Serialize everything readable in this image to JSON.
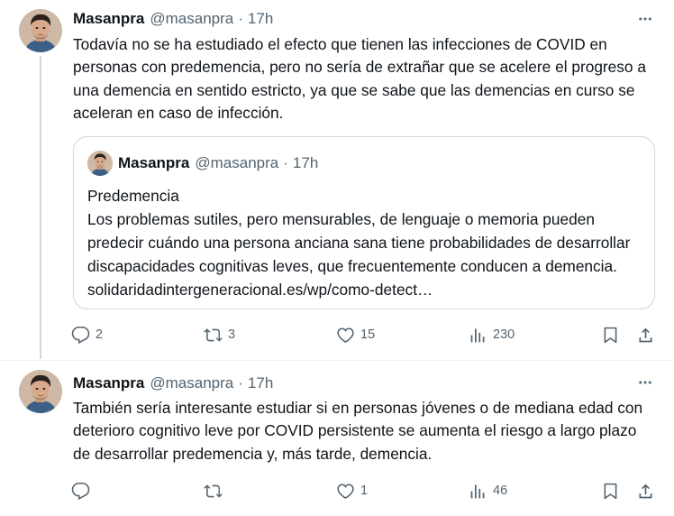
{
  "tweets": [
    {
      "name": "Masanpra",
      "handle": "@masanpra",
      "dot": "·",
      "time": "17h",
      "text": "Todavía no se ha estudiado el efecto que tienen las infecciones de COVID en personas con predemencia, pero no sería de extrañar que se acelere el progreso a una demencia en sentido estricto, ya que se sabe que las demencias en curso se aceleran en caso de infección.",
      "quote": {
        "name": "Masanpra",
        "handle": "@masanpra",
        "dot": "·",
        "time": "17h",
        "title": "Predemencia",
        "text": "Los problemas sutiles, pero mensurables, de lenguaje o memoria pueden predecir cuándo una persona anciana sana tiene probabilidades de desarrollar discapacidades cognitivas leves, que frecuentemente conducen a demencia. solidaridadintergeneracional.es/wp/como-detect…"
      },
      "replies": "2",
      "retweets": "3",
      "likes": "15",
      "views": "230"
    },
    {
      "name": "Masanpra",
      "handle": "@masanpra",
      "dot": "·",
      "time": "17h",
      "text": "También sería interesante estudiar si en personas jóvenes o de mediana edad con deterioro cognitivo leve por COVID persistente se aumenta el riesgo a largo plazo de desarrollar predemencia y, más tarde, demencia.",
      "replies": "",
      "retweets": "",
      "likes": "1",
      "views": "46"
    }
  ],
  "icons": {
    "more": "more-horizontal-icon",
    "reply": "reply-icon",
    "retweet": "retweet-icon",
    "like": "heart-icon",
    "views": "views-icon",
    "bookmark": "bookmark-icon",
    "share": "share-icon"
  },
  "colors": {
    "text": "#0f1419",
    "secondary": "#536471",
    "border": "#cfd9de"
  }
}
